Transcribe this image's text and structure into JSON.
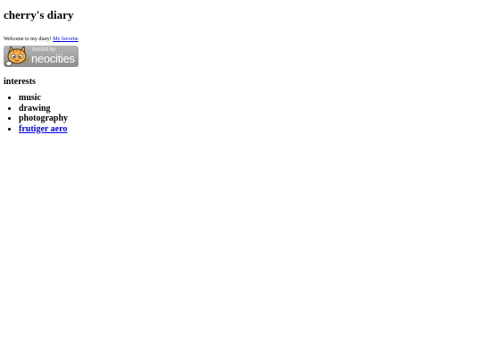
{
  "page": {
    "title": "cherry's diary",
    "welcome_text": "Welcome to my diary! ",
    "favorite_link": "My favorite"
  },
  "badge": {
    "hosted_by": "hosted by",
    "brand": "neocities",
    "icon": "neocities-cat-icon"
  },
  "interests": {
    "heading": "interests",
    "items": [
      {
        "label": "music"
      },
      {
        "label": "drawing"
      },
      {
        "label": "photography"
      },
      {
        "label": "frutiger aero"
      }
    ]
  },
  "colors": {
    "link": "#0000ee",
    "text": "#000000",
    "badge_bg": "#a3a3a3"
  }
}
